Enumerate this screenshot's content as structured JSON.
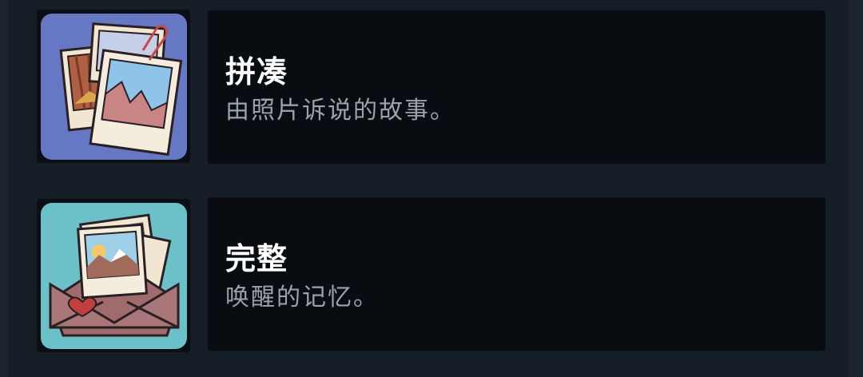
{
  "achievements": [
    {
      "title": "拼凑",
      "description": "由照片诉说的故事。",
      "icon": "photo-collage-icon",
      "icon_bg": "#6678c4"
    },
    {
      "title": "完整",
      "description": "唤醒的记忆。",
      "icon": "envelope-photos-icon",
      "icon_bg": "#6cc0c7"
    }
  ]
}
